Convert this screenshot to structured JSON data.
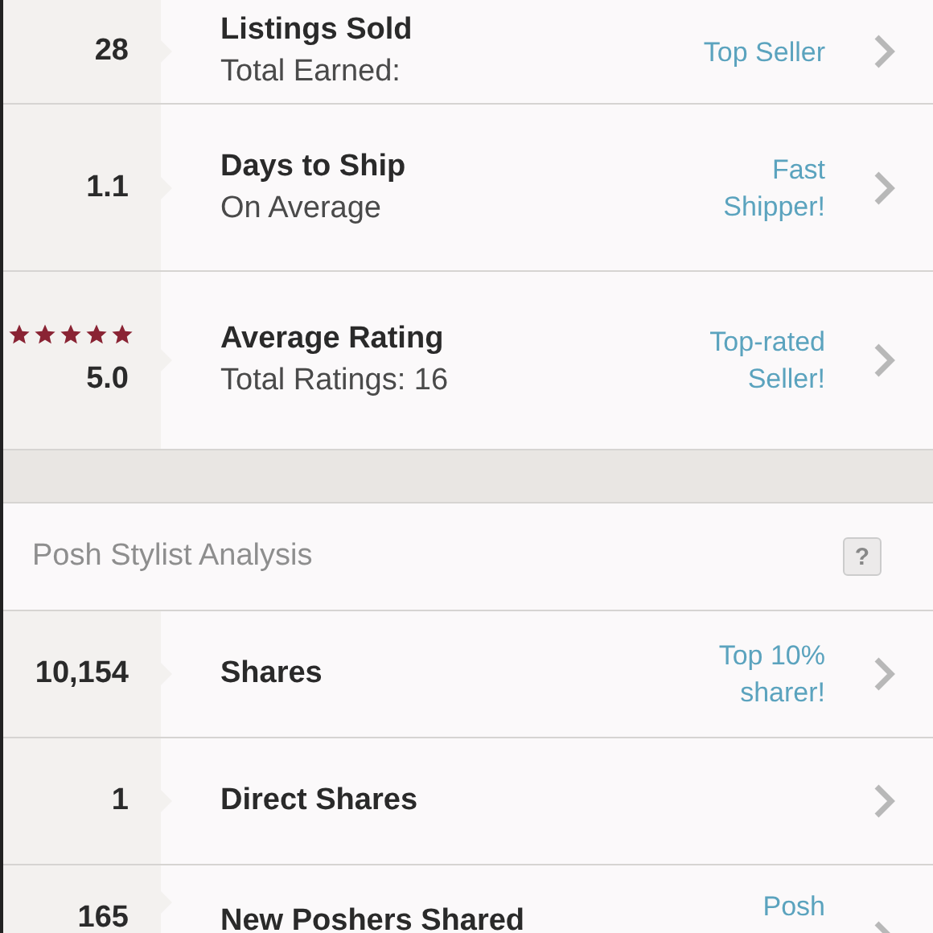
{
  "seller_stats": [
    {
      "value": "28",
      "title": "Listings Sold",
      "subtitle": "Total Earned:",
      "badge": "Top Seller"
    },
    {
      "value": "1.1",
      "title": "Days to Ship",
      "subtitle": "On Average",
      "badge": "Fast Shipper!"
    },
    {
      "value": "5.0",
      "stars": 5,
      "title": "Average Rating",
      "subtitle": "Total Ratings: 16",
      "badge": "Top-rated Seller!"
    }
  ],
  "stylist_section": {
    "title": "Posh Stylist Analysis",
    "help_button": "?"
  },
  "stylist_stats": [
    {
      "value": "10,154",
      "title": "Shares",
      "badge": "Top 10% sharer!"
    },
    {
      "value": "1",
      "title": "Direct Shares"
    },
    {
      "value": "165",
      "title": "New Poshers Shared",
      "badge": "Posh"
    }
  ]
}
